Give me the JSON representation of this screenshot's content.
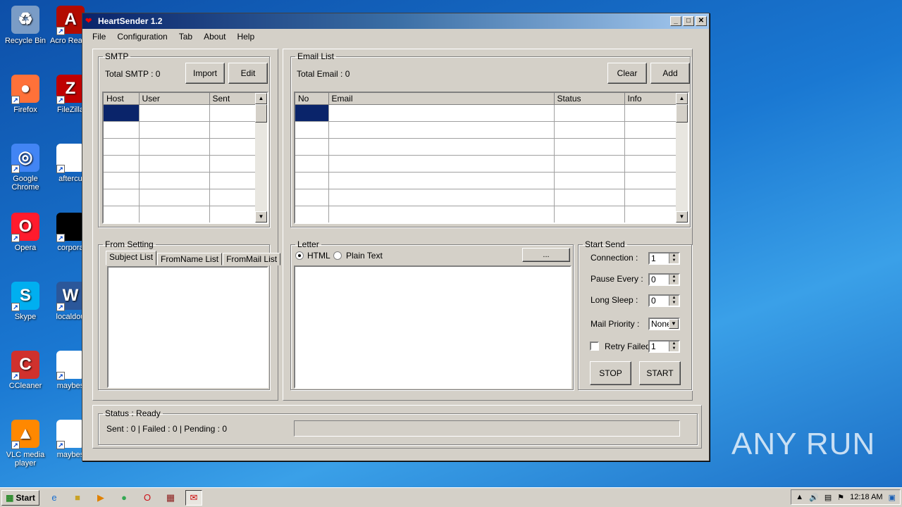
{
  "desktop": {
    "icons": [
      {
        "label": "Recycle Bin",
        "icon": "recycle-bin-icon",
        "color": "#7a9cc6"
      },
      {
        "label": "Acro Reade",
        "icon": "acrobat-icon",
        "color": "#b30b00"
      },
      {
        "label": "Firefox",
        "icon": "firefox-icon",
        "color": "#ff7139"
      },
      {
        "label": "FileZilla",
        "icon": "filezilla-icon",
        "color": "#bf0000"
      },
      {
        "label": "Google Chrome",
        "icon": "chrome-icon",
        "color": "#4285f4"
      },
      {
        "label": "aftercu",
        "icon": "file-icon",
        "color": "#ffffff"
      },
      {
        "label": "Opera",
        "icon": "opera-icon",
        "color": "#ff1b2d"
      },
      {
        "label": "corpora",
        "icon": "file-icon",
        "color": "#000000"
      },
      {
        "label": "Skype",
        "icon": "skype-icon",
        "color": "#00aff0"
      },
      {
        "label": "localdou",
        "icon": "word-icon",
        "color": "#2b579a"
      },
      {
        "label": "CCleaner",
        "icon": "ccleaner-icon",
        "color": "#d0312d"
      },
      {
        "label": "maybes",
        "icon": "file-icon",
        "color": "#ffffff"
      },
      {
        "label": "VLC media player",
        "icon": "vlc-icon",
        "color": "#ff8800"
      },
      {
        "label": "maybes",
        "icon": "file-icon",
        "color": "#ffffff"
      }
    ]
  },
  "window": {
    "title": "HeartSender 1.2",
    "menu": [
      "File",
      "Configuration",
      "Tab",
      "About",
      "Help"
    ]
  },
  "smtp": {
    "legend": "SMTP",
    "total": "Total SMTP : 0",
    "import_label": "Import",
    "edit_label": "Edit",
    "columns": [
      "Host",
      "User",
      "Sent"
    ]
  },
  "email_list": {
    "legend": "Email List",
    "total": "Total Email : 0",
    "clear_label": "Clear",
    "add_label": "Add",
    "columns": [
      "No",
      "Email",
      "Status",
      "Info"
    ]
  },
  "from_setting": {
    "legend": "From Setting",
    "tabs": [
      "Subject List",
      "FromName List",
      "FromMail List"
    ]
  },
  "letter": {
    "legend": "Letter",
    "html_label": "HTML",
    "plain_label": "Plain Text",
    "browse_label": "..."
  },
  "start_send": {
    "legend": "Start Send",
    "connection_label": "Connection   :",
    "connection_value": "1",
    "pause_label": "Pause Every :",
    "pause_value": "0",
    "sleep_label": "Long Sleep   :",
    "sleep_value": "0",
    "priority_label": "Mail Priority    :",
    "priority_value": "None",
    "retry_label": "Retry Failed",
    "retry_value": "1",
    "stop_label": "STOP",
    "start_label": "START"
  },
  "status": {
    "legend": "Status : Ready",
    "counts": "Sent : 0 | Failed : 0 | Pending : 0",
    "progress": 0
  },
  "taskbar": {
    "start_label": "Start",
    "clock": "12:18 AM"
  },
  "watermark": "ANY RUN"
}
